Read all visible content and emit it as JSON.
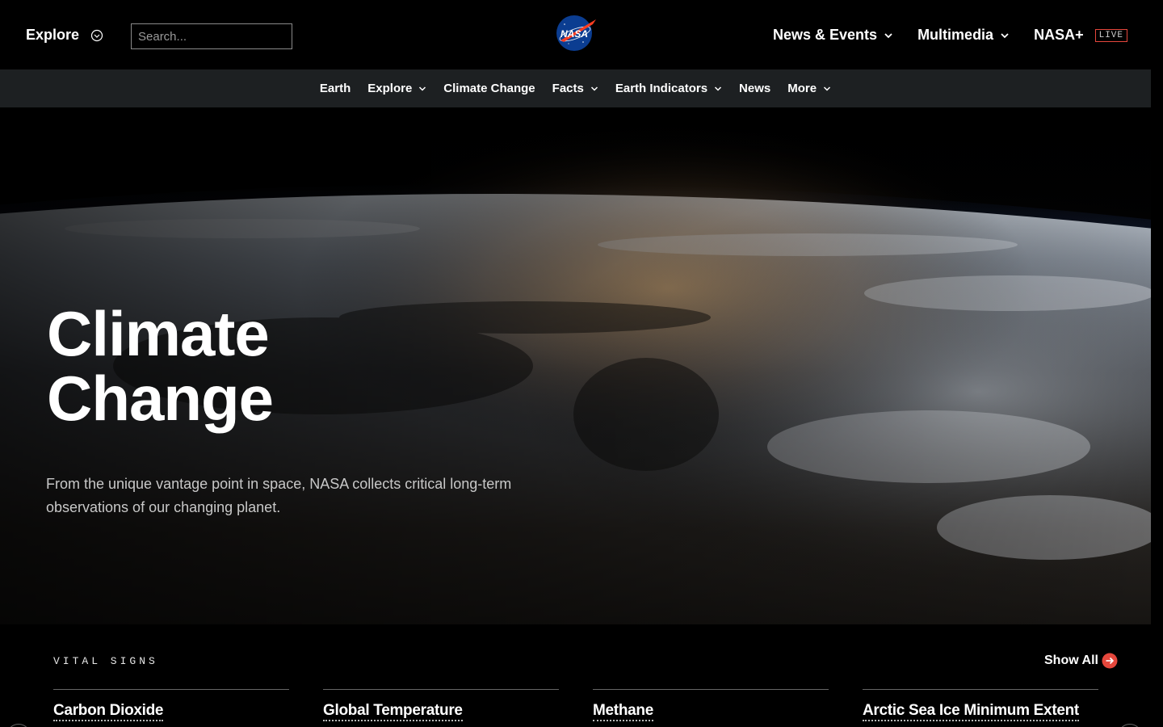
{
  "header": {
    "explore_label": "Explore",
    "search_placeholder": "Search...",
    "logo_text": "NASA",
    "nav": [
      {
        "label": "News & Events",
        "has_dropdown": true
      },
      {
        "label": "Multimedia",
        "has_dropdown": true
      },
      {
        "label": "NASA+",
        "badge": "LIVE"
      }
    ]
  },
  "subnav": {
    "items": [
      {
        "label": "Earth",
        "has_dropdown": false
      },
      {
        "label": "Explore",
        "has_dropdown": true
      },
      {
        "label": "Climate Change",
        "has_dropdown": false
      },
      {
        "label": "Facts",
        "has_dropdown": true
      },
      {
        "label": "Earth Indicators",
        "has_dropdown": true
      },
      {
        "label": "News",
        "has_dropdown": false
      },
      {
        "label": "More",
        "has_dropdown": true
      }
    ]
  },
  "hero": {
    "title_line1": "Climate",
    "title_line2": "Change",
    "subtitle": "From the unique vantage point in space, NASA collects critical long-term observations of our changing planet."
  },
  "vital_signs": {
    "label": "VITAL SIGNS",
    "show_all": "Show All",
    "cards": [
      {
        "title": "Carbon Dioxide"
      },
      {
        "title": "Global Temperature"
      },
      {
        "title": "Methane"
      },
      {
        "title": "Arctic Sea Ice Minimum Extent"
      }
    ]
  },
  "colors": {
    "accent": "#e5473c",
    "subnav_bg": "#1d2022",
    "background": "#000000"
  }
}
